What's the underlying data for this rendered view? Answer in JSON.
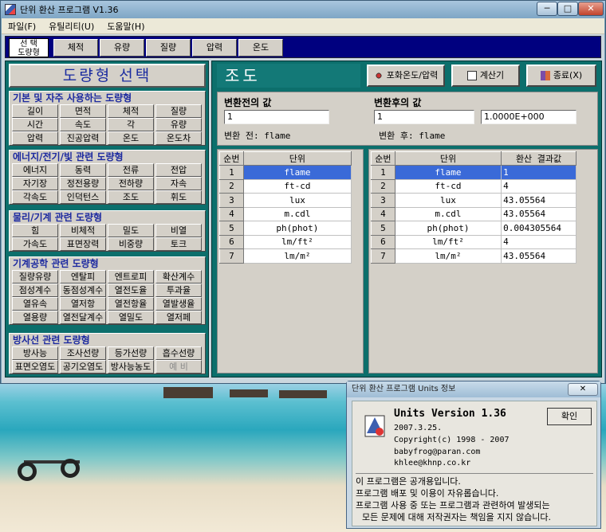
{
  "window": {
    "title": "단위 환산 프로그램 V1.36",
    "min": "─",
    "max": "□",
    "close": "✕"
  },
  "menu": [
    "파일(F)",
    "유틸리티(U)",
    "도움말(H)"
  ],
  "toolbar": {
    "selected_line1": "선  택",
    "selected_line2": "도량형",
    "buttons": [
      "체적",
      "유량",
      "질량",
      "압력",
      "온도"
    ]
  },
  "left": {
    "header": "도량형 선택",
    "groups": [
      {
        "title": "기본 및 자주 사용하는 도량형",
        "items": [
          "길이",
          "면적",
          "체적",
          "질량",
          "시간",
          "속도",
          "각",
          "유량",
          "압력",
          "진공압력",
          "온도",
          "온도차"
        ]
      },
      {
        "title": "에너지/전기/빛 관련 도량형",
        "items": [
          "에너지",
          "동력",
          "전류",
          "전압",
          "자기장",
          "정전용량",
          "전하량",
          "자속",
          "각속도",
          "인덕턴스",
          "조도",
          "휘도"
        ]
      },
      {
        "title": "물리/기계 관련 도량형",
        "items": [
          "힘",
          "비체적",
          "밀도",
          "비열",
          "가속도",
          "표면장력",
          "비중량",
          "토크"
        ]
      },
      {
        "title": "기계공학 관련 도량형",
        "items": [
          "질량유량",
          "엔탈피",
          "엔트로피",
          "확산계수",
          "점성계수",
          "동점성계수",
          "열전도율",
          "투과율",
          "열유속",
          "열저항",
          "열전항율",
          "열발생율",
          "열용량",
          "열전달계수",
          "열밀도",
          "열저페"
        ]
      },
      {
        "title": "방사선 관련 도량형",
        "items": [
          "방사능",
          "조사선량",
          "등가선량",
          "흡수선량",
          "표면오염도",
          "공기오염도",
          "방사능농도",
          "예 비"
        ]
      }
    ]
  },
  "right": {
    "title": "조도",
    "buttons": {
      "saturation": "포화온도/압력",
      "calculator": "계산기",
      "exit": "종료(X)"
    },
    "before_label": "변환전의 값",
    "after_label": "변환후의 값",
    "before_value": "1",
    "after_value": "1",
    "result_value": "1.0000E+000",
    "before_unit_text": "변환 전: flame",
    "after_unit_text": "변환 후: flame",
    "left_table": {
      "headers": [
        "순번",
        "단위"
      ],
      "rows": [
        [
          "1",
          "flame"
        ],
        [
          "2",
          "ft-cd"
        ],
        [
          "3",
          "lux"
        ],
        [
          "4",
          "m.cdl"
        ],
        [
          "5",
          "ph(phot)"
        ],
        [
          "6",
          "lm/ft²"
        ],
        [
          "7",
          "lm/m²"
        ]
      ]
    },
    "right_table": {
      "headers": [
        "순번",
        "단위",
        "환산 결과값"
      ],
      "rows": [
        [
          "1",
          "flame",
          "1"
        ],
        [
          "2",
          "ft-cd",
          "4"
        ],
        [
          "3",
          "lux",
          "43.05564"
        ],
        [
          "4",
          "m.cdl",
          "43.05564"
        ],
        [
          "5",
          "ph(phot)",
          "0.004305564"
        ],
        [
          "6",
          "lm/ft²",
          "4"
        ],
        [
          "7",
          "lm/m²",
          "43.05564"
        ]
      ]
    }
  },
  "about": {
    "title": "단위 환산 프로그램 Units 정보",
    "close": "✕",
    "name": "Units Version 1.36",
    "date": "2007.3.25.",
    "copyright": "Copyright(c) 1998 - 2007",
    "email1": "babyfrog@paran.com",
    "email2": "khlee@khnp.co.kr",
    "ok": "확인",
    "message": [
      "이 프로그램은 공개용입니다.",
      "프로그램 배포 및 이용이 자유롭습니다.",
      "프로그램 사용 중 또는 프로그램과 관련하여 발생되는",
      "모든 문제에 대해 저작권자는 책임을 지지 않습니다."
    ]
  }
}
